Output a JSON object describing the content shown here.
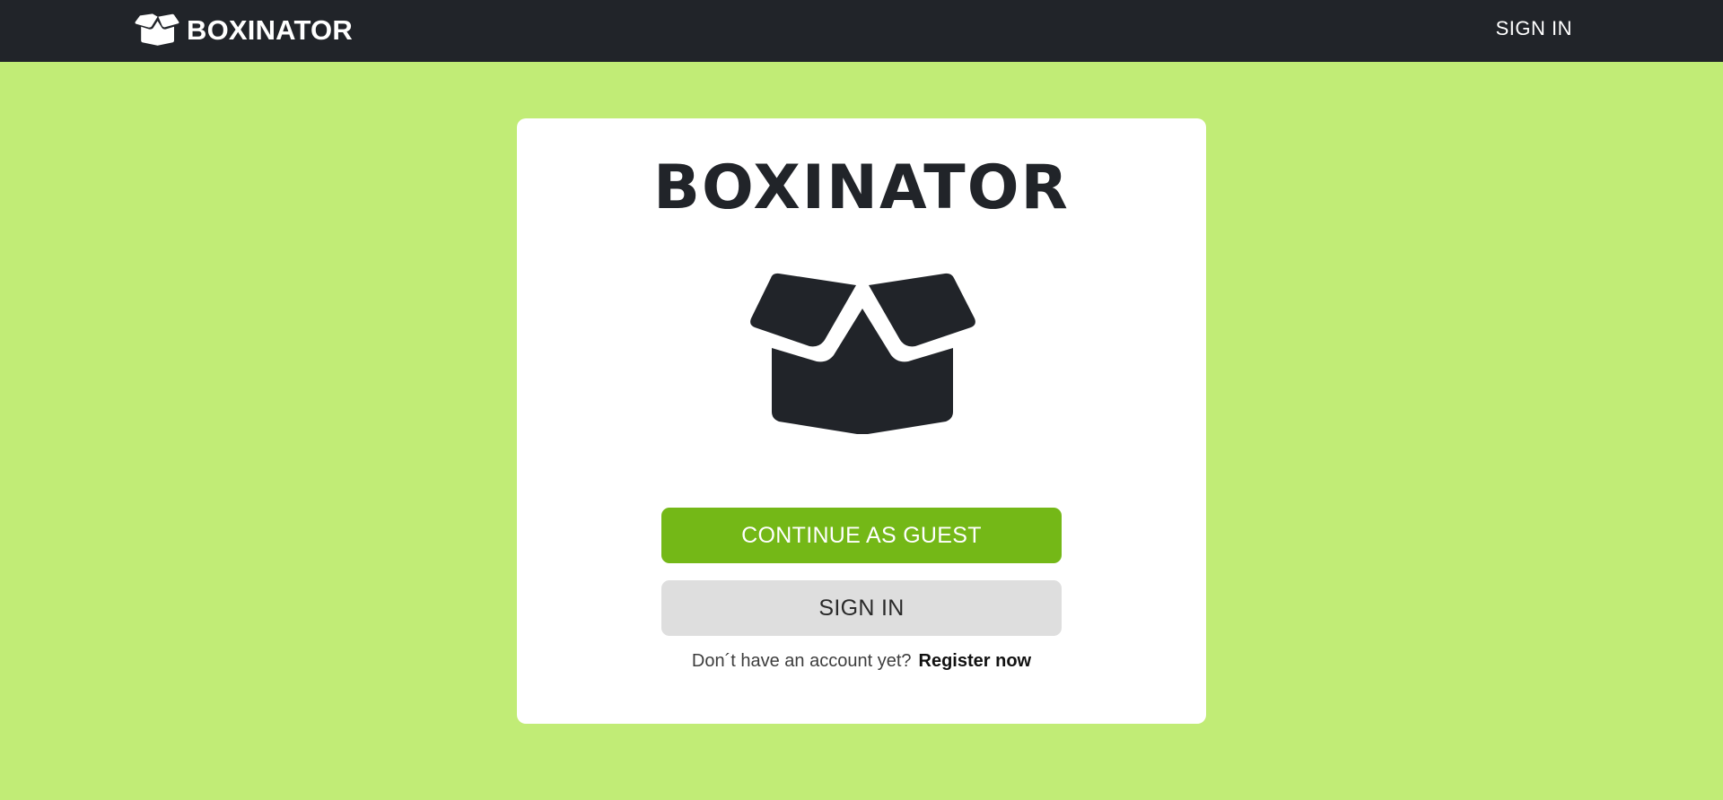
{
  "navbar": {
    "brand": "BOXINATOR",
    "brand_icon": "open-box-icon",
    "sign_in_label": "SIGN IN"
  },
  "card": {
    "title": "BOXINATOR",
    "logo_icon": "open-box-icon",
    "continue_guest_label": "CONTINUE AS GUEST",
    "sign_in_label": "SIGN IN",
    "register_prompt": "Don´t have an account yet?",
    "register_link": "Register now"
  },
  "colors": {
    "background": "#c1ec76",
    "navbar": "#212429",
    "primary_button": "#74b817",
    "secondary_button": "#dedede",
    "icon": "#212429"
  }
}
